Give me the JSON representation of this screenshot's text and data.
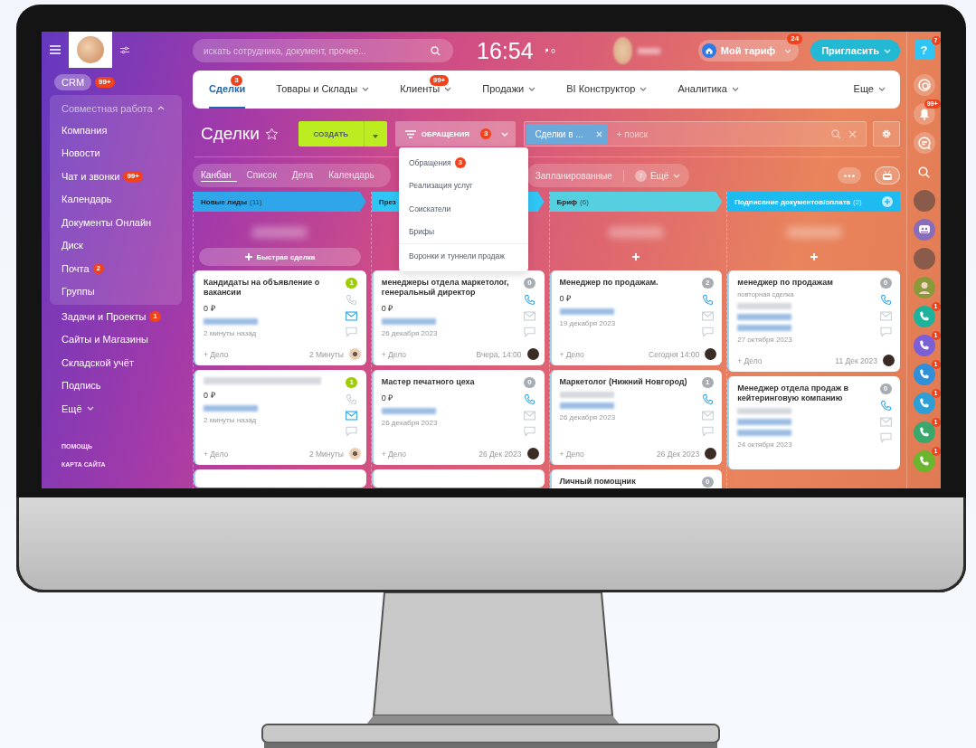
{
  "sidebar": {
    "crm": {
      "label": "CRM",
      "badge": "99+"
    },
    "group": {
      "label": "Совместная работа",
      "expanded": true,
      "children": [
        {
          "label": "Компания"
        },
        {
          "label": "Новости"
        },
        {
          "label": "Чат и звонки",
          "badge": "99+"
        },
        {
          "label": "Календарь"
        },
        {
          "label": "Документы Онлайн"
        },
        {
          "label": "Диск"
        },
        {
          "label": "Почта",
          "badge": "2"
        },
        {
          "label": "Группы"
        }
      ]
    },
    "items": [
      {
        "label": "Задачи и Проекты",
        "badge": "1",
        "caret": false
      },
      {
        "label": "Сайты и Магазины",
        "caret": false
      },
      {
        "label": "Складской учёт",
        "caret": false
      },
      {
        "label": "Подпись",
        "caret": false
      },
      {
        "label": "Ещё",
        "caret": true
      }
    ],
    "footer_links": [
      "ПОМОЩЬ",
      "КАРТА САЙТА"
    ]
  },
  "topbar": {
    "search": {
      "placeholder": "искать сотрудника, документ, прочее..."
    },
    "clock": "16:54",
    "flags": "0",
    "tariff": {
      "label": "Мой тариф",
      "badge": "24"
    },
    "invite": {
      "label": "Пригласить"
    }
  },
  "nav": {
    "tabs": [
      {
        "label": "Сделки",
        "selected": true,
        "badge": "3",
        "caret": false
      },
      {
        "label": "Товары и Склады",
        "selected": false,
        "caret": true
      },
      {
        "label": "Клиенты",
        "selected": false,
        "badge": "99+",
        "caret": true
      },
      {
        "label": "Продажи",
        "selected": false,
        "caret": true
      },
      {
        "label": "BI Конструктор",
        "selected": false,
        "caret": true
      },
      {
        "label": "Аналитика",
        "selected": false,
        "caret": true
      },
      {
        "label": "Еще",
        "selected": false,
        "caret": true
      }
    ]
  },
  "toolbar": {
    "title": "Сделки",
    "create": "СОЗДАТЬ",
    "filter": {
      "label": "ОБРАЩЕНИЯ",
      "badge": "3"
    },
    "chip": "Сделки в ...",
    "search": {
      "placeholder": "+ поиск"
    }
  },
  "views": {
    "tabs": [
      {
        "label": "Канбан",
        "selected": true
      },
      {
        "label": "Список",
        "selected": false
      },
      {
        "label": "Дела",
        "selected": false
      },
      {
        "label": "Календарь",
        "selected": false
      }
    ],
    "chips": [
      {
        "label": "Запланированные"
      },
      {
        "label": "Ещё",
        "count": "7"
      }
    ]
  },
  "dropdown": {
    "items": [
      {
        "label": "Обращения",
        "badge": "3",
        "divider_before": false
      },
      {
        "label": "Реализация услуг",
        "divider_before": false
      },
      {
        "label": "Соискатели",
        "divider_before": false
      },
      {
        "label": "Брифы",
        "divider_before": false
      },
      {
        "label": "Воронки и туннели продаж",
        "divider_before": true
      }
    ]
  },
  "board": {
    "columns": [
      {
        "name": "Новые лиды",
        "count": "(11)",
        "color": "#2fa6ea",
        "add_button": true,
        "header_plus": false,
        "quick_add": "Быстрая сделка",
        "cards": [
          {
            "kind": "deal",
            "title": "Кандидаты на объявление о вакансии",
            "counter": {
              "text": "1",
              "color": "#9dcf00"
            },
            "amount": "0 ₽",
            "redacted": [
              {
                "kind": "link"
              }
            ],
            "date": "2 минуты назад",
            "activity": "+ Дело",
            "time": "2 Минуты",
            "phone_active": false,
            "mail_active": true,
            "avatar": {
              "kind": "logo"
            }
          },
          {
            "kind": "deal",
            "title_redacted": true,
            "counter": {
              "text": "1",
              "color": "#9dcf00"
            },
            "amount": "0 ₽",
            "redacted": [
              {
                "kind": "link"
              }
            ],
            "date": "2 минуты назад",
            "activity": "+ Дело",
            "time": "2 Минуты",
            "phone_active": false,
            "mail_active": true,
            "avatar": {
              "kind": "logo"
            }
          },
          {
            "kind": "stub"
          }
        ]
      },
      {
        "name": "През",
        "color": "#2fc6f6",
        "add_button": false,
        "header_plus": false,
        "cards": [
          {
            "kind": "deal",
            "title": "менеджеры отдела маркетолог, генеральный директор",
            "counter": {
              "text": "0",
              "color": "#a8adb4"
            },
            "amount": "0 ₽",
            "redacted": [
              {
                "kind": "link"
              }
            ],
            "date": "26 декабря 2023",
            "activity": "+ Дело",
            "time": "Вчера, 14:00",
            "phone_active": true,
            "mail_active": false,
            "avatar": {
              "kind": "photo"
            }
          },
          {
            "kind": "deal",
            "title": "Мастер печатного цеха",
            "counter": {
              "text": "0",
              "color": "#a8adb4"
            },
            "amount": "0 ₽",
            "redacted": [
              {
                "kind": "link"
              }
            ],
            "date": "26 декабря 2023",
            "activity": "+ Дело",
            "time": "26 Дек 2023",
            "phone_active": true,
            "mail_active": false,
            "avatar": {
              "kind": "photo"
            }
          },
          {
            "kind": "stub"
          }
        ]
      },
      {
        "name": "Бриф",
        "count": "(6)",
        "color": "#55d0e0",
        "add_button": true,
        "header_plus": false,
        "cards": [
          {
            "kind": "deal",
            "title": "Менеджер по продажам.",
            "counter": {
              "text": "2",
              "color": "#a8adb4"
            },
            "amount": "0 ₽",
            "redacted": [
              {
                "kind": "link"
              }
            ],
            "date": "19 декабря 2023",
            "activity": "+ Дело",
            "time": "Сегодня 14:00",
            "phone_active": true,
            "mail_active": false,
            "avatar": {
              "kind": "photo"
            }
          },
          {
            "kind": "deal",
            "title": "Маркетолог (Нижний Новгород)",
            "counter": {
              "text": "1",
              "color": "#a8adb4"
            },
            "redacted": [
              {
                "kind": "plain"
              },
              {
                "kind": "link"
              }
            ],
            "date": "26 декабря 2023",
            "activity": "+ Дело",
            "time": "26 Дек 2023",
            "phone_active": true,
            "mail_active": false,
            "avatar": {
              "kind": "photo"
            }
          },
          {
            "kind": "deal",
            "title": "Личный помощник",
            "counter": {
              "text": "0",
              "color": "#a8adb4"
            }
          }
        ]
      },
      {
        "name": "Подписание документов/оплата",
        "count": "(2)",
        "color": "#1ebbf0",
        "add_button": true,
        "header_plus": true,
        "cards": [
          {
            "kind": "deal",
            "title": "менеджер по продажам",
            "subtitle": "повторная сделка",
            "counter": {
              "text": "0",
              "color": "#a8adb4"
            },
            "redacted": [
              {
                "kind": "plain"
              },
              {
                "kind": "link"
              },
              {
                "kind": "link"
              }
            ],
            "date": "27 октября 2023",
            "activity": "+ Дело",
            "time": "11 Дек 2023",
            "phone_active": true,
            "mail_active": false,
            "avatar": {
              "kind": "photo"
            }
          },
          {
            "kind": "deal",
            "title": "Менеджер отдела продаж в кейтеринговую компанию",
            "counter": {
              "text": "0",
              "color": "#a8adb4"
            },
            "redacted": [
              {
                "kind": "plain"
              },
              {
                "kind": "link"
              },
              {
                "kind": "link"
              }
            ],
            "date": "24 октября 2023",
            "phone_active": true,
            "mail_active": false
          }
        ]
      }
    ]
  },
  "rail": {
    "items": [
      {
        "kind": "help",
        "label": "?",
        "badge": "7"
      },
      {
        "kind": "copilot"
      },
      {
        "kind": "notifications",
        "badge": "99+"
      },
      {
        "kind": "messages"
      },
      {
        "kind": "search"
      },
      {
        "kind": "avatar"
      },
      {
        "kind": "group-chat"
      },
      {
        "kind": "avatar"
      },
      {
        "kind": "silhouette"
      },
      {
        "kind": "call",
        "color": "#1fb29a",
        "badge": "1"
      },
      {
        "kind": "call",
        "color": "#7b5fd6",
        "badge": "1"
      },
      {
        "kind": "call",
        "color": "#2f8fd8",
        "badge": "1"
      },
      {
        "kind": "call",
        "color": "#2d9fd6",
        "badge": "1"
      },
      {
        "kind": "call",
        "color": "#3aa76d",
        "badge": "1"
      },
      {
        "kind": "call",
        "color": "#6cb52f",
        "badge": "1"
      }
    ]
  }
}
